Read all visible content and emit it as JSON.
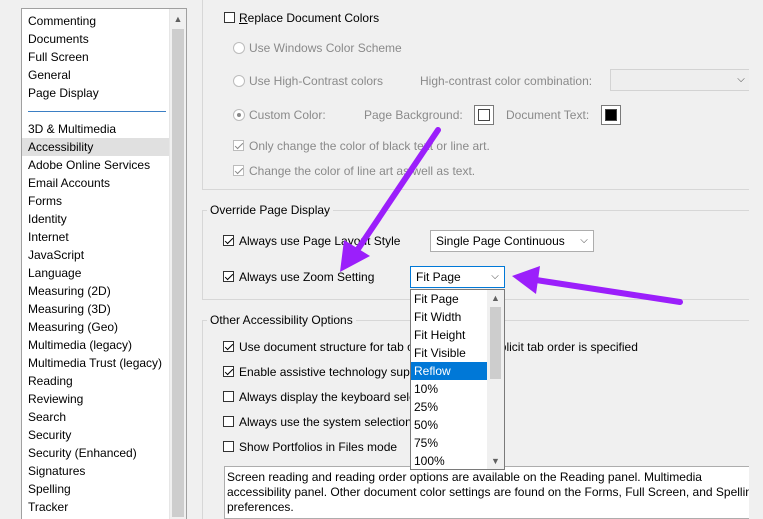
{
  "categories": {
    "top": [
      "Commenting",
      "Documents",
      "Full Screen",
      "General",
      "Page Display"
    ],
    "bottom": [
      "3D & Multimedia",
      "Accessibility",
      "Adobe Online Services",
      "Email Accounts",
      "Forms",
      "Identity",
      "Internet",
      "JavaScript",
      "Language",
      "Measuring (2D)",
      "Measuring (3D)",
      "Measuring (Geo)",
      "Multimedia (legacy)",
      "Multimedia Trust (legacy)",
      "Reading",
      "Reviewing",
      "Search",
      "Security",
      "Security (Enhanced)",
      "Signatures",
      "Spelling",
      "Tracker"
    ],
    "selected": "Accessibility"
  },
  "document_colors": {
    "replace_label": "Replace Document Colors",
    "use_windows_scheme": "Use Windows Color Scheme",
    "use_high_contrast": "Use High-Contrast colors",
    "high_contrast_combo_label": "High-contrast color combination:",
    "custom_color": "Custom Color:",
    "page_background": "Page Background:",
    "document_text": "Document Text:",
    "only_black_text": "Only change the color of black text or line art.",
    "change_line_art": "Change the color of line art as well as text."
  },
  "override_page_display": {
    "title": "Override Page Display",
    "page_layout_label": "Always use Page Layout Style",
    "page_layout_value": "Single Page Continuous",
    "zoom_label": "Always use Zoom Setting",
    "zoom_value": "Fit Page"
  },
  "zoom_options": [
    "Fit Page",
    "Fit Width",
    "Fit Height",
    "Fit Visible",
    "Reflow",
    "10%",
    "25%",
    "50%",
    "75%",
    "100%"
  ],
  "zoom_highlighted": "Reflow",
  "other_options": {
    "title": "Other Accessibility Options",
    "doc_structure": "Use document structure for tab order when no explicit tab order is specified",
    "assistive_tech": "Enable assistive technology support",
    "keyboard_selection": "Always display the keyboard selection cursor",
    "system_selection": "Always use the system selection color",
    "portfolios": "Show Portfolios in Files mode"
  },
  "info_text": "Screen reading and reading order options are available on the Reading panel. Multimedia accessibility panel. Other document color settings are found on the Forms, Full Screen, and Spelling preferences.",
  "colors": {
    "arrow": "#9b1ffb",
    "highlight": "#0078d7",
    "selected_item": "#e0e0e0"
  }
}
